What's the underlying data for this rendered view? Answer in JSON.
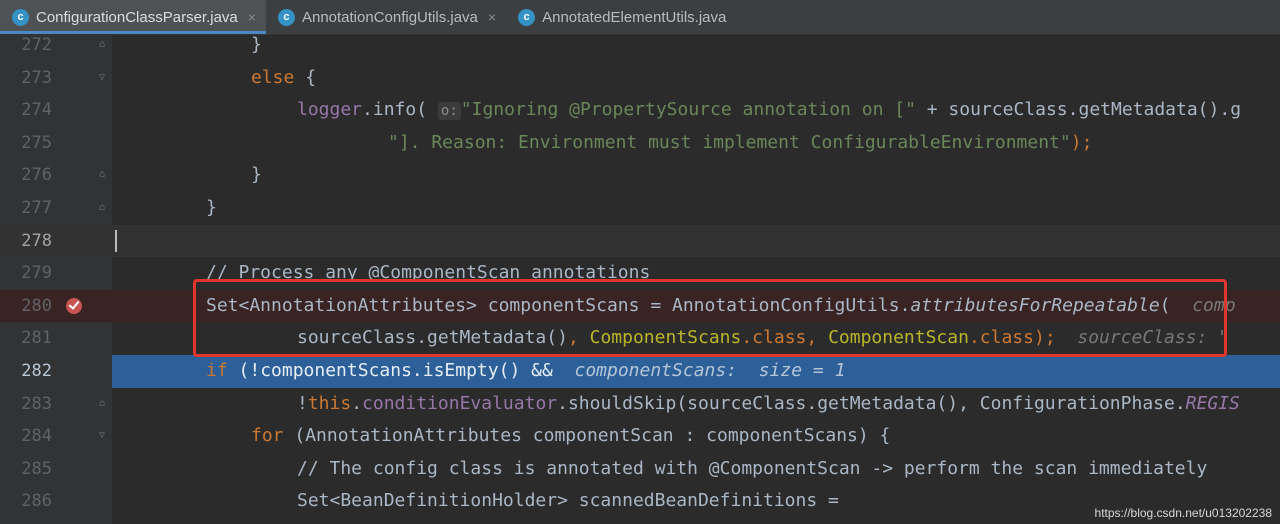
{
  "tabs": [
    {
      "label": "ConfigurationClassParser.java",
      "close": "×",
      "active": true
    },
    {
      "label": "AnnotationConfigUtils.java",
      "close": "×",
      "active": false
    },
    {
      "label": "AnnotatedElementUtils.java",
      "active": false
    }
  ],
  "tab_icon_letter": "c",
  "lines": {
    "l272": {
      "num": "272",
      "t1": "}"
    },
    "l273": {
      "num": "273",
      "t1": "else",
      "t2": " {"
    },
    "l274": {
      "num": "274",
      "t1": "logger",
      "t2": ".info(",
      "t3": "o:",
      "t4": "\"Ignoring @PropertySource annotation on [\"",
      "t5": " + sourceClass.getMetadata().g"
    },
    "l275": {
      "num": "275",
      "t1": "\"]. Reason: Environment must implement ConfigurableEnvironment\"",
      "t2": ");"
    },
    "l276": {
      "num": "276",
      "t1": "}"
    },
    "l277": {
      "num": "277",
      "t1": "}"
    },
    "l278": {
      "num": "278"
    },
    "l279": {
      "num": "279",
      "t1": "// Process any @ComponentScan annotations"
    },
    "l280": {
      "num": "280",
      "t1": "Set<AnnotationAttributes> componentScans = AnnotationConfigUtils.",
      "t2": "attributesForRepeatable",
      "t3": "(",
      "t4": "comp"
    },
    "l281": {
      "num": "281",
      "t1": "sourceClass.getMetadata()",
      "t2": ", ",
      "t3": "ComponentScans",
      "t4": ".class",
      "t5": ", ",
      "t6": "ComponentScan",
      "t7": ".class",
      "t8": ");",
      "t9": "sourceClass: \""
    },
    "l282": {
      "num": "282",
      "t1": "if",
      "t2": " (!componentScans.isEmpty() &&",
      "t3": "componentScans:  size = 1"
    },
    "l283": {
      "num": "283",
      "t1": "!",
      "t2": "this",
      "t3": ".",
      "t4": "conditionEvaluator",
      "t5": ".shouldSkip(sourceClass.getMetadata(), ConfigurationPhase.",
      "t6": "REGIS"
    },
    "l284": {
      "num": "284",
      "t1": "for",
      "t2": " (AnnotationAttributes componentScan : componentScans) {"
    },
    "l285": {
      "num": "285",
      "t1": "// The config class is annotated with @ComponentScan -> perform the scan immediately"
    },
    "l286": {
      "num": "286",
      "t1": "Set<BeanDefinitionHolder> scannedBeanDefinitions ="
    }
  },
  "watermark": "https://blog.csdn.net/u013202238",
  "colors": {
    "current_line": "#2d6099",
    "highlight_box": "#e0362c",
    "breakpoint": "#c75450"
  }
}
